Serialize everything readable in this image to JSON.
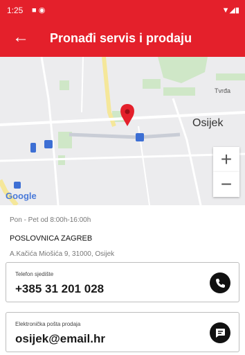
{
  "status": {
    "time": "1:25"
  },
  "header": {
    "title": "Pronađi servis i prodaju"
  },
  "map": {
    "labels": {
      "city": "Osijek",
      "district": "Tvrđa"
    },
    "zoom_in": "+",
    "zoom_out": "−",
    "attribution": "Google"
  },
  "location": {
    "hours": "Pon - Pet od 8:00h-16:00h",
    "name": "POSLOVNICA ZAGREB",
    "address": "A.Kačića Miošića 9, 31000, Osijek"
  },
  "contacts": {
    "phone": {
      "label": "Telefon sjedište",
      "value": "+385 31 201 028"
    },
    "email": {
      "label": "Elektronička pošta prodaja",
      "value": "osijek@email.hr"
    }
  },
  "colors": {
    "accent": "#e4202b"
  },
  "icons": {
    "back": "arrow-left-icon",
    "phone": "phone-icon",
    "chat": "chat-icon",
    "pin": "map-pin-icon"
  }
}
